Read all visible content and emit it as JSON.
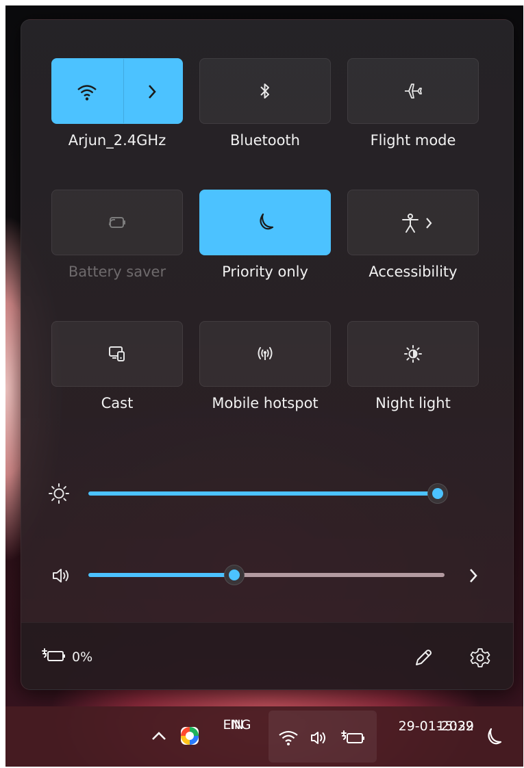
{
  "tiles": [
    {
      "label": "Arjun_2.4GHz",
      "icon": "wifi-icon",
      "state": "on"
    },
    {
      "label": "Bluetooth",
      "icon": "bluetooth-icon",
      "state": "off"
    },
    {
      "label": "Flight mode",
      "icon": "airplane-icon",
      "state": "off"
    },
    {
      "label": "Battery saver",
      "icon": "battery-saver-icon",
      "state": "disabled"
    },
    {
      "label": "Priority only",
      "icon": "moon-icon",
      "state": "on"
    },
    {
      "label": "Accessibility",
      "icon": "accessibility-icon",
      "state": "off"
    },
    {
      "label": "Cast",
      "icon": "cast-icon",
      "state": "off"
    },
    {
      "label": "Mobile hotspot",
      "icon": "hotspot-icon",
      "state": "off"
    },
    {
      "label": "Night light",
      "icon": "night-light-icon",
      "state": "off"
    }
  ],
  "sliders": {
    "brightness": {
      "icon": "brightness-icon",
      "value": 0.98
    },
    "volume": {
      "icon": "speaker-icon",
      "value": 0.41
    }
  },
  "footer": {
    "battery_text": "0%",
    "battery_icon": "battery-charging-icon",
    "edit_icon": "pencil-icon",
    "settings_icon": "gear-icon"
  },
  "taskbar": {
    "language_line1": "ENG",
    "language_line2": "IN",
    "time": "15:39",
    "date": "29-01-2022",
    "icons": [
      "chevron-up-icon",
      "app-icon",
      "wifi-icon",
      "speaker-icon",
      "battery-charging-icon",
      "moon-icon"
    ]
  },
  "colors": {
    "accent": "#4cc2ff",
    "panel": "#262428",
    "volume_track_rest": "#b39aa0"
  }
}
